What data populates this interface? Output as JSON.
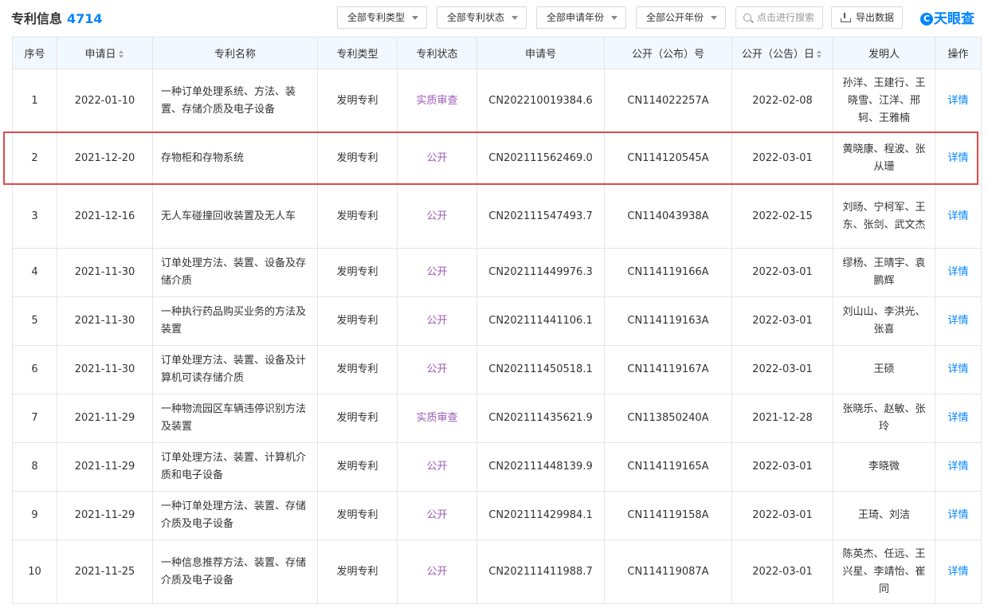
{
  "header": {
    "title": "专利信息",
    "count": "4714",
    "filters": [
      "全部专利类型",
      "全部专利状态",
      "全部申请年份",
      "全部公开年份"
    ],
    "search_placeholder": "点击进行搜索",
    "export_label": "导出数据",
    "logo_text": "天眼查",
    "logo_mark": "C"
  },
  "table": {
    "columns": [
      "序号",
      "申请日",
      "专利名称",
      "专利类型",
      "专利状态",
      "申请号",
      "公开（公布）号",
      "公开（公告）日",
      "发明人",
      "操作"
    ],
    "rows": [
      {
        "no": "1",
        "date": "2022-01-10",
        "name": "一种订单处理系统、方法、装置、存储介质及电子设备",
        "type": "发明专利",
        "status": "实质审查",
        "app_no": "CN202210019384.6",
        "pub_no": "CN114022257A",
        "pub_date": "2022-02-08",
        "inventors": "孙洋、王建行、王晓雪、江洋、邢轲、王雅楠",
        "action": "详情"
      },
      {
        "no": "2",
        "date": "2021-12-20",
        "name": "存物柜和存物系统",
        "type": "发明专利",
        "status": "公开",
        "app_no": "CN202111562469.0",
        "pub_no": "CN114120545A",
        "pub_date": "2022-03-01",
        "inventors": "黄晓康、程波、张从珊",
        "action": "详情"
      },
      {
        "no": "3",
        "date": "2021-12-16",
        "name": "无人车碰撞回收装置及无人车",
        "type": "发明专利",
        "status": "公开",
        "app_no": "CN202111547493.7",
        "pub_no": "CN114043938A",
        "pub_date": "2022-02-15",
        "inventors": "刘旸、宁柯军、王东、张剑、武文杰",
        "action": "详情"
      },
      {
        "no": "4",
        "date": "2021-11-30",
        "name": "订单处理方法、装置、设备及存储介质",
        "type": "发明专利",
        "status": "公开",
        "app_no": "CN202111449976.3",
        "pub_no": "CN114119166A",
        "pub_date": "2022-03-01",
        "inventors": "缪杨、王晴宇、袁鹏辉",
        "action": "详情"
      },
      {
        "no": "5",
        "date": "2021-11-30",
        "name": "一种执行药品购买业务的方法及装置",
        "type": "发明专利",
        "status": "公开",
        "app_no": "CN202111441106.1",
        "pub_no": "CN114119163A",
        "pub_date": "2022-03-01",
        "inventors": "刘山山、李洪光、张喜",
        "action": "详情"
      },
      {
        "no": "6",
        "date": "2021-11-30",
        "name": "订单处理方法、装置、设备及计算机可读存储介质",
        "type": "发明专利",
        "status": "公开",
        "app_no": "CN202111450518.1",
        "pub_no": "CN114119167A",
        "pub_date": "2022-03-01",
        "inventors": "王硕",
        "action": "详情"
      },
      {
        "no": "7",
        "date": "2021-11-29",
        "name": "一种物流园区车辆违停识别方法及装置",
        "type": "发明专利",
        "status": "实质审查",
        "app_no": "CN202111435621.9",
        "pub_no": "CN113850240A",
        "pub_date": "2021-12-28",
        "inventors": "张晓乐、赵敏、张玲",
        "action": "详情"
      },
      {
        "no": "8",
        "date": "2021-11-29",
        "name": "订单处理方法、装置、计算机介质和电子设备",
        "type": "发明专利",
        "status": "公开",
        "app_no": "CN202111448139.9",
        "pub_no": "CN114119165A",
        "pub_date": "2022-03-01",
        "inventors": "李晓微",
        "action": "详情"
      },
      {
        "no": "9",
        "date": "2021-11-29",
        "name": "一种订单处理方法、装置、存储介质及电子设备",
        "type": "发明专利",
        "status": "公开",
        "app_no": "CN202111429984.1",
        "pub_no": "CN114119158A",
        "pub_date": "2022-03-01",
        "inventors": "王琦、刘洁",
        "action": "详情"
      },
      {
        "no": "10",
        "date": "2021-11-25",
        "name": "一种信息推荐方法、装置、存储介质及电子设备",
        "type": "发明专利",
        "status": "公开",
        "app_no": "CN202111411988.7",
        "pub_no": "CN114119087A",
        "pub_date": "2022-03-01",
        "inventors": "陈英杰、任远、王兴星、李靖怡、崔同",
        "action": "详情"
      }
    ]
  },
  "colors": {
    "accent": "#0084ff",
    "status": "#9b59b6",
    "highlight": "#e0484d",
    "header_bg": "#f2f8ff"
  }
}
